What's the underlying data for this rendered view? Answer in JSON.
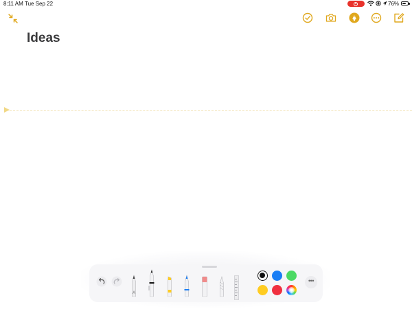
{
  "status_bar": {
    "time": "8:11 AM",
    "date": "Tue Sep 22",
    "battery_text": "76%",
    "battery_level": 0.76,
    "recording_indicator_color": "#e8322b"
  },
  "toolbar": {
    "accent_color": "#e0a81e",
    "icons": [
      "collapse-icon",
      "checklist-icon",
      "camera-icon",
      "markup-icon",
      "more-icon",
      "compose-icon"
    ]
  },
  "note": {
    "title": "Ideas"
  },
  "palette": {
    "tools": [
      "pen",
      "marker",
      "highlighter",
      "pencil",
      "eraser",
      "lasso",
      "ruler"
    ],
    "colors": {
      "black": "#111111",
      "blue": "#1a7ef5",
      "green": "#4cd964",
      "yellow": "#ffcc22",
      "red": "#f0303f"
    },
    "selected_color": "black",
    "more_label": "•••"
  }
}
